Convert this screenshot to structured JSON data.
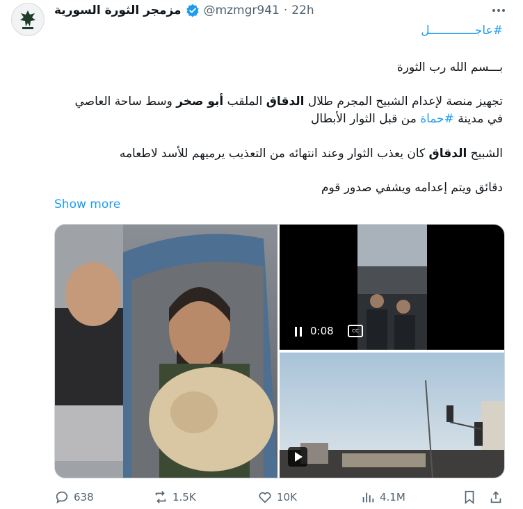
{
  "tweet": {
    "author_name": "مزمجر الثورة السورية",
    "handle": "@mzmgr941",
    "separator": "·",
    "time": "22h",
    "hashtag_line": "#عاجـــــــــــــل",
    "line1": "بـــسم الله رب الثورة",
    "p2_l1_a": "تجهيز منصة لإعدام الشبيح المجرم طلال ",
    "p2_l1_b": "الدقاق",
    "p2_l1_c": " الملقب ",
    "p2_l1_d": "أبو صخر",
    "p2_l1_e": " وسط ساحة العاصي",
    "p2_l2_a": "في مدينة ",
    "p2_l2_tag": "#حماة",
    "p2_l2_b": " من قبل الثوار الأبطال",
    "p3_a": "الشبيح ",
    "p3_b": "الدقاق",
    "p3_c": " كان يعذب الثوار وعند انتهائه من التعذيب يرميهم للأسد لاطعامه",
    "p4": "دقائق ويتم إعدامه ويشفي صدور قوم",
    "show_more": "Show more"
  },
  "video": {
    "time": "0:08",
    "cc_label": "CC"
  },
  "stats": {
    "replies": "638",
    "reposts": "1.5K",
    "likes": "10K",
    "views": "4.1M"
  },
  "colors": {
    "accent": "#1d9bf0",
    "muted": "#536471",
    "text": "#0f1419"
  },
  "icons": [
    "avatar-logo",
    "verified-badge-icon",
    "more-icon",
    "pause-icon",
    "cc-icon",
    "play-icon",
    "reply-icon",
    "repost-icon",
    "like-icon",
    "views-icon",
    "bookmark-icon",
    "share-icon"
  ]
}
